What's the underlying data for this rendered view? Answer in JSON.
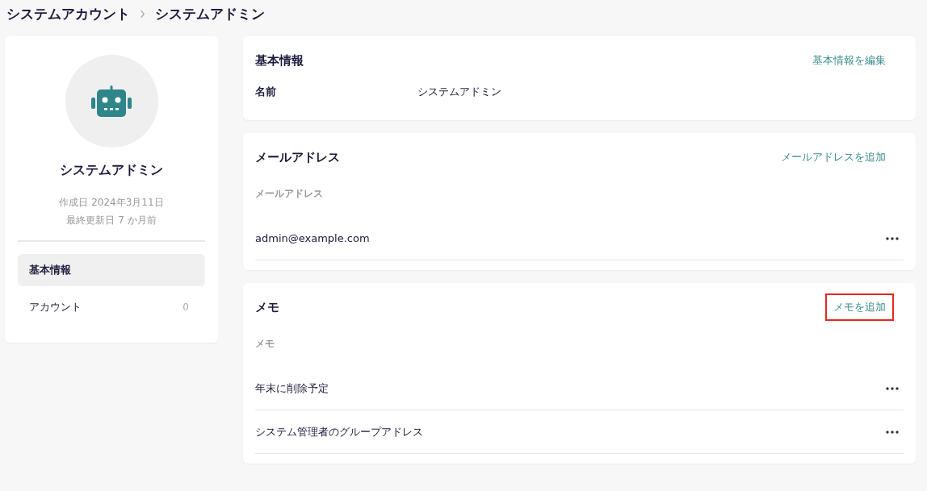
{
  "breadcrumb": [
    "システムアカウント",
    "システムアドミン"
  ],
  "profile": {
    "name": "システムアドミン",
    "created": "作成日 2024年3月11日",
    "updated": "最終更新日 7 か月前"
  },
  "nav": [
    {
      "label": "基本情報",
      "selected": true
    },
    {
      "label": "アカウント",
      "count": "0",
      "selected": false
    }
  ],
  "basic": {
    "title": "基本情報",
    "action": "基本情報を編集",
    "fields": [
      {
        "label": "名前",
        "value": "システムアドミン"
      }
    ]
  },
  "lists": [
    {
      "title": "メールアドレス",
      "action": "メールアドレスを追加",
      "highlighted": false,
      "column_header": "メールアドレス",
      "rows": [
        "admin@example.com"
      ]
    },
    {
      "title": "メモ",
      "action": "メモを追加",
      "highlighted": true,
      "column_header": "メモ",
      "rows": [
        "年末に削除予定",
        "システム管理者のグループアドレス"
      ]
    }
  ]
}
